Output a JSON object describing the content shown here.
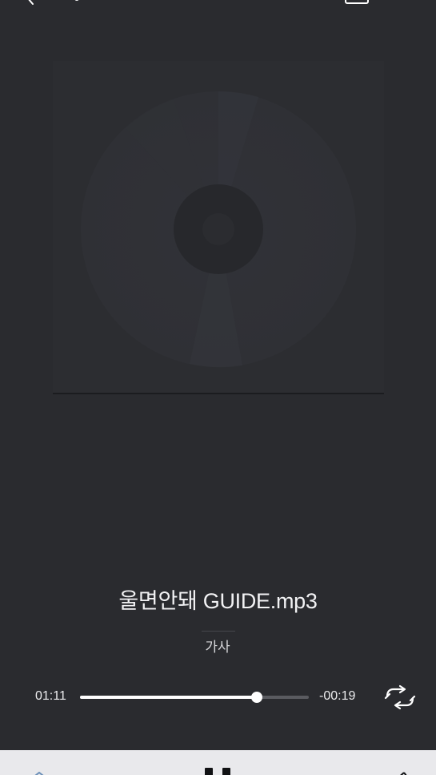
{
  "player": {
    "song_title": "울면안돼 GUIDE.mp3",
    "lyrics_label": "가사",
    "elapsed_time": "01:11",
    "remaining_time": "-00:19",
    "progress_fraction": 0.774
  },
  "icons": {
    "back": "chevron-left-icon",
    "top_right": "list-icon",
    "album_art": "disc-icon",
    "repeat": "repeat-icon",
    "pause": "pause-icon",
    "control_left": "previous-icon",
    "control_right": "next-icon"
  },
  "colors": {
    "background": "#2a2b2f",
    "controls_bar": "#e9e9ec",
    "progress_fill": "#ffffff",
    "progress_track": "#5a5b60"
  }
}
